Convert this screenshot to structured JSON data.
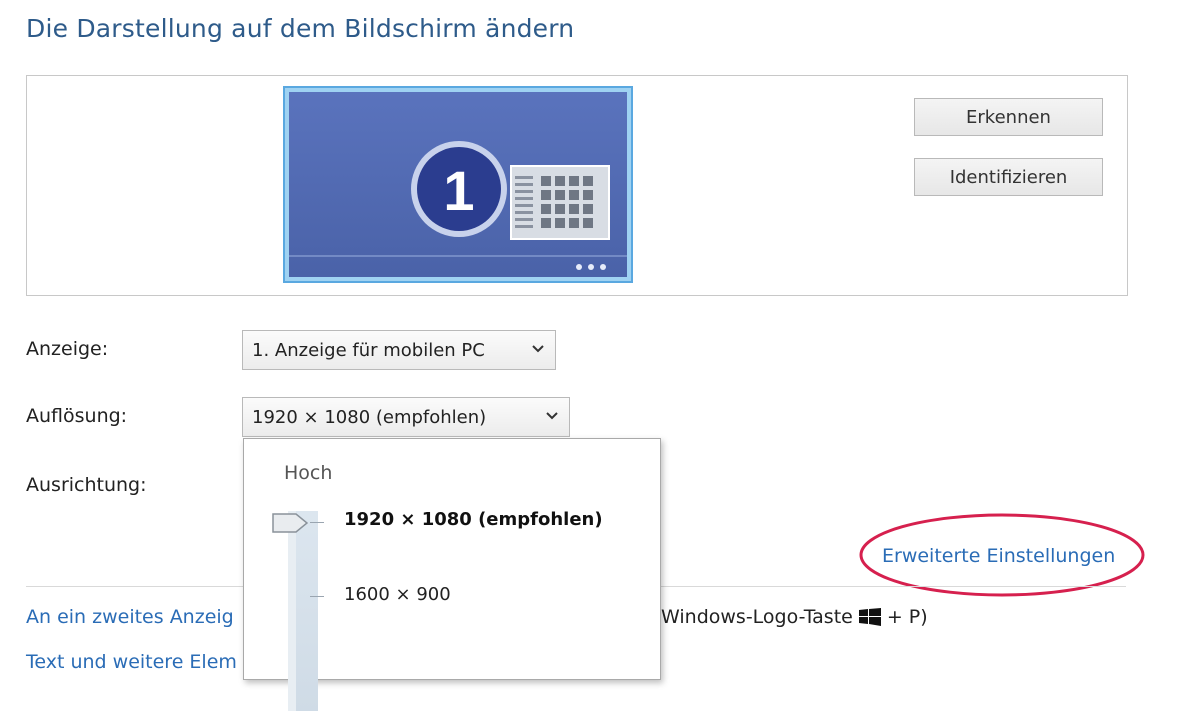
{
  "page": {
    "title": "Die Darstellung auf dem Bildschirm ändern"
  },
  "preview": {
    "monitor_number": "1",
    "buttons": {
      "detect": "Erkennen",
      "identify": "Identifizieren"
    }
  },
  "settings": {
    "display_label": "Anzeige:",
    "display_value": "1. Anzeige für mobilen PC",
    "resolution_label": "Auflösung:",
    "resolution_value": "1920 × 1080 (empfohlen)",
    "orientation_label": "Ausrichtung:"
  },
  "resolution_dropdown": {
    "top_label": "Hoch",
    "options": [
      {
        "label": "1920 × 1080 (empfohlen)",
        "selected": true
      },
      {
        "label": "1600 × 900",
        "selected": false
      }
    ]
  },
  "links": {
    "advanced": "Erweiterte Einstellungen",
    "second_display": "An ein zweites Anzeig",
    "text_elements": "Text und weitere Elem"
  },
  "hint": {
    "prefix": "Windows-Logo-Taste",
    "suffix": "+ P)"
  },
  "colors": {
    "title": "#2e5b8a",
    "link": "#2a6cb6",
    "highlight_ellipse": "#d6204e",
    "monitor_bg": "#4f68b0"
  },
  "icons": [
    "monitor-icon",
    "chevron-down-icon",
    "windows-logo-icon"
  ]
}
